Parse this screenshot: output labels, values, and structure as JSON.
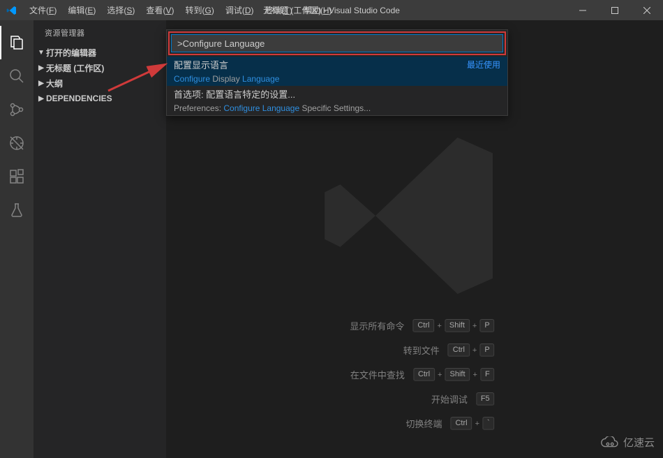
{
  "titlebar": {
    "title": "无标题 (工作区) - Visual Studio Code",
    "menu": [
      {
        "label": "文件",
        "mnemonic": "F"
      },
      {
        "label": "编辑",
        "mnemonic": "E"
      },
      {
        "label": "选择",
        "mnemonic": "S"
      },
      {
        "label": "查看",
        "mnemonic": "V"
      },
      {
        "label": "转到",
        "mnemonic": "G"
      },
      {
        "label": "调试",
        "mnemonic": "D"
      },
      {
        "label": "终端",
        "mnemonic": "T"
      },
      {
        "label": "帮助",
        "mnemonic": "H"
      }
    ]
  },
  "activity": {
    "items": [
      {
        "name": "explorer-icon",
        "active": true
      },
      {
        "name": "search-icon",
        "active": false
      },
      {
        "name": "source-control-icon",
        "active": false
      },
      {
        "name": "debug-icon",
        "active": false
      },
      {
        "name": "extensions-icon",
        "active": false
      },
      {
        "name": "test-icon",
        "active": false
      }
    ]
  },
  "sidebar": {
    "title": "资源管理器",
    "sections": [
      {
        "label": "打开的编辑器",
        "expanded": true
      },
      {
        "label": "无标题 (工作区)",
        "expanded": false
      },
      {
        "label": "大纲",
        "expanded": false
      },
      {
        "label": "DEPENDENCIES",
        "expanded": false
      }
    ]
  },
  "palette": {
    "input_value": ">Configure Language",
    "items": [
      {
        "label_zh": "配置显示语言",
        "label_en_parts": [
          "Configure",
          " Display ",
          "Language"
        ],
        "right": "最近使用",
        "selected": true
      },
      {
        "label_zh": "首选项: 配置语言特定的设置...",
        "label_en_parts_mixed": "Preferences: <hl>Configure Language</hl> Specific Settings...",
        "selected": false
      }
    ]
  },
  "shortcuts": [
    {
      "label": "显示所有命令",
      "keys": [
        "Ctrl",
        "Shift",
        "P"
      ]
    },
    {
      "label": "转到文件",
      "keys": [
        "Ctrl",
        "P"
      ]
    },
    {
      "label": "在文件中查找",
      "keys": [
        "Ctrl",
        "Shift",
        "F"
      ]
    },
    {
      "label": "开始调试",
      "keys": [
        "F5"
      ]
    },
    {
      "label": "切换终端",
      "keys": [
        "Ctrl",
        "`"
      ]
    }
  ],
  "watermark_brand": "亿速云"
}
